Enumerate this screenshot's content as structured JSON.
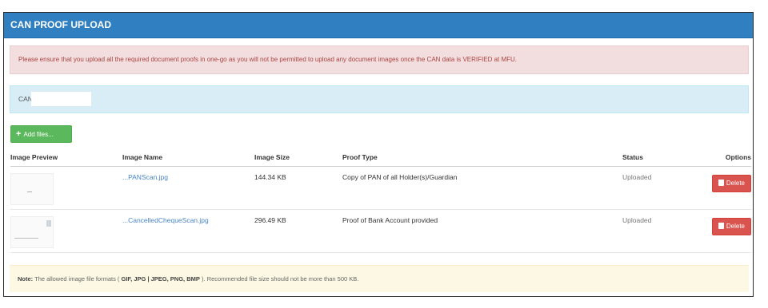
{
  "panel": {
    "title": "CAN PROOF UPLOAD"
  },
  "alert": {
    "text": "Please ensure that you upload all the required document proofs in one-go as you will not be permitted to upload any document images once the CAN data is VERIFIED at MFU."
  },
  "can": {
    "label": "CAN"
  },
  "toolbar": {
    "add_files_label": "Add files..."
  },
  "table": {
    "headers": [
      "Image Preview",
      "Image Name",
      "Image Size",
      "Proof Type",
      "Status",
      "Options"
    ],
    "rows": [
      {
        "name": "...PANScan.jpg",
        "size": "144.34 KB",
        "proof": "Copy of PAN of all Holder(s)/Guardian",
        "status": "Uploaded",
        "delete": "Delete"
      },
      {
        "name": "...CancelledChequeScan.jpg",
        "size": "296.49 KB",
        "proof": "Proof of Bank Account provided",
        "status": "Uploaded",
        "delete": "Delete"
      }
    ]
  },
  "note": {
    "label": "Note:",
    "prefix": "The allowed image file formats (",
    "formats": "GIF, JPG | JPEG, PNG, BMP",
    "suffix": "). Recommended file size should not be more than 500 KB."
  },
  "colors": {
    "header": "#2f7fc1",
    "danger_bg": "#f2dede",
    "info_bg": "#d9edf7",
    "success": "#5cb85c",
    "delete": "#d9534f",
    "note_bg": "#fcf8e3"
  }
}
